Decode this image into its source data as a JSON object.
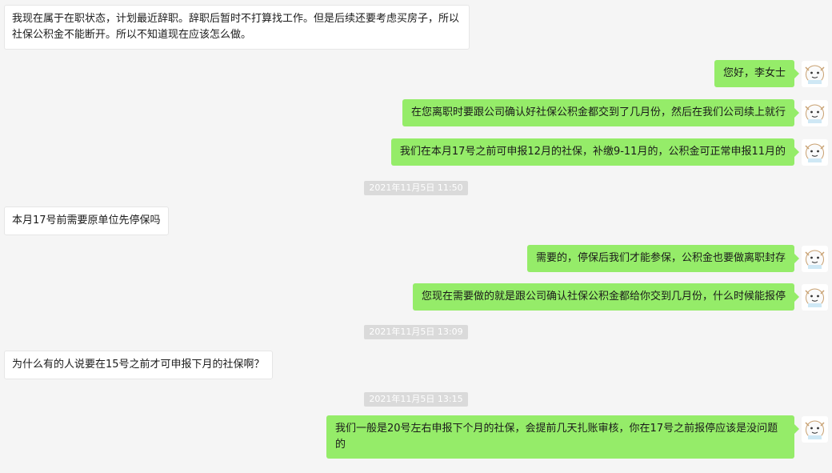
{
  "messages": [
    {
      "side": "left",
      "text": "我现在属于在职状态，计划最近辞职。辞职后暂时不打算找工作。但是后续还要考虑买房子，所以社保公积金不能断开。所以不知道现在应该怎么做。"
    },
    {
      "side": "right",
      "text": "您好，李女士"
    },
    {
      "side": "right",
      "text": "在您离职时要跟公司确认好社保公积金都交到了几月份，然后在我们公司续上就行"
    },
    {
      "side": "right",
      "text": "我们在本月17号之前可申报12月的社保，补缴9-11月的，公积金可正常申报11月的"
    },
    {
      "side": "time",
      "text": "2021年11月5日 11:50"
    },
    {
      "side": "left",
      "text": "本月17号前需要原单位先停保吗"
    },
    {
      "side": "right",
      "text": "需要的，停保后我们才能参保，公积金也要做离职封存"
    },
    {
      "side": "right",
      "text": "您现在需要做的就是跟公司确认社保公积金都给你交到几月份，什么时候能报停"
    },
    {
      "side": "time",
      "text": "2021年11月5日 13:09"
    },
    {
      "side": "left",
      "text": "为什么有的人说要在15号之前才可申报下月的社保啊？"
    },
    {
      "side": "time",
      "text": "2021年11月5日 13:15"
    },
    {
      "side": "right",
      "text": "我们一般是20号左右申报下个月的社保，会提前几天扎账审核，你在17号之前报停应该是没问题的"
    }
  ],
  "avatar_icon": "cartoon-avatar-icon",
  "colors": {
    "background": "#f5f5f5",
    "bubble_self": "#95ec69",
    "bubble_other": "#ffffff",
    "timestamp_bg": "#dadada"
  }
}
